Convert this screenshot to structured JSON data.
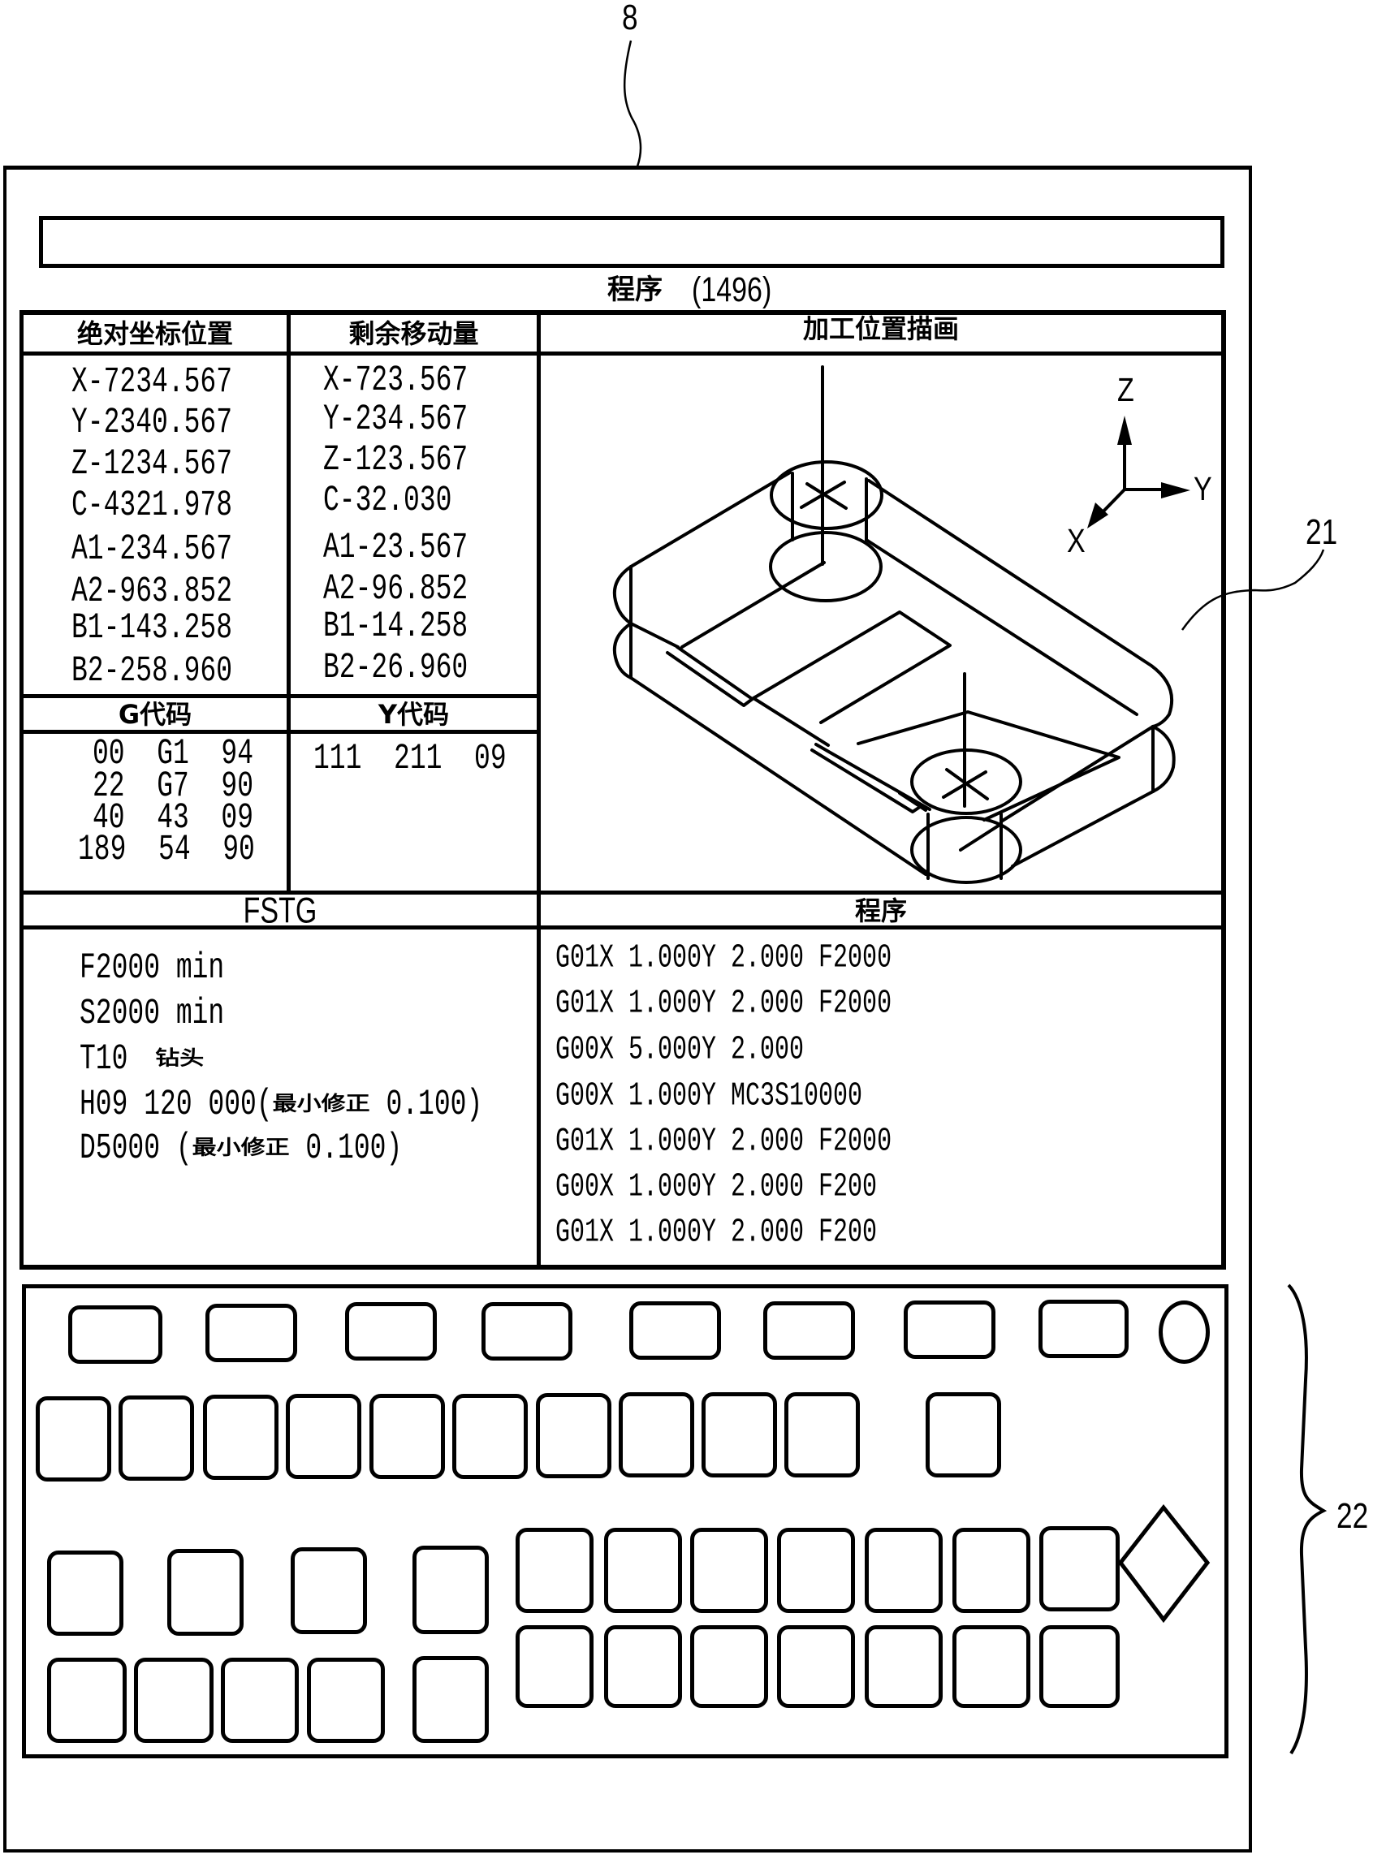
{
  "reference_labels": {
    "device": "8",
    "drawing_area": "21",
    "keyboard": "22"
  },
  "header": {
    "input_bar_value": "",
    "title": "程序",
    "program_number": "(1496)"
  },
  "absolute_position": {
    "header": "绝对坐标位置",
    "rows": [
      "X-7234.567",
      "Y-2340.567",
      "Z-1234.567",
      "C-4321.978",
      "A1-234.567",
      "A2-963.852",
      "B1-143.258",
      "B2-258.960"
    ]
  },
  "remaining_travel": {
    "header": "剩余移动量",
    "rows": [
      "X-723.567",
      "Y-234.567",
      "Z-123.567",
      "C-32.030",
      "A1-23.567",
      "A2-96.852",
      "B1-14.258",
      "B2-26.960"
    ]
  },
  "g_code": {
    "header": "G代码",
    "rows": [
      "00  G1  94",
      "22  G7  90",
      "40  43  09",
      "189  54  90"
    ]
  },
  "y_code": {
    "header": "Y代码",
    "rows": [
      "111  211  09"
    ]
  },
  "drawing": {
    "header": "加工位置描画",
    "axes": {
      "z": "Z",
      "y": "Y",
      "x": "X"
    }
  },
  "fstg": {
    "header": "FSTG",
    "rows": [
      {
        "code": "F2000 min",
        "text": ""
      },
      {
        "code": "S2000 min",
        "text": ""
      },
      {
        "code": "T10 ",
        "text": "钻头"
      },
      {
        "code": "H09 120 000(",
        "text": "最小修正",
        "tail": " 0.100)"
      },
      {
        "code": "D5000 (",
        "text": "最小修正",
        "tail": " 0.100)"
      }
    ]
  },
  "program": {
    "header": "程序",
    "lines": [
      "G01X 1.000Y 2.000 F2000",
      "G01X 1.000Y 2.000 F2000",
      "G00X 5.000Y 2.000",
      "G00X 1.000Y MC3S10000",
      "G01X 1.000Y 2.000 F2000",
      "G00X 1.000Y 2.000 F200",
      "G01X 1.000Y 2.000 F200"
    ]
  },
  "keyboard": {
    "row1_key_count": 8,
    "row2_key_count": 11,
    "row3_left_key_count": 4,
    "row3_right_key_count": 7,
    "row4_left_key_count": 5,
    "row4_right_key_count": 7,
    "special_keys": [
      "round-button",
      "diamond-button"
    ]
  }
}
